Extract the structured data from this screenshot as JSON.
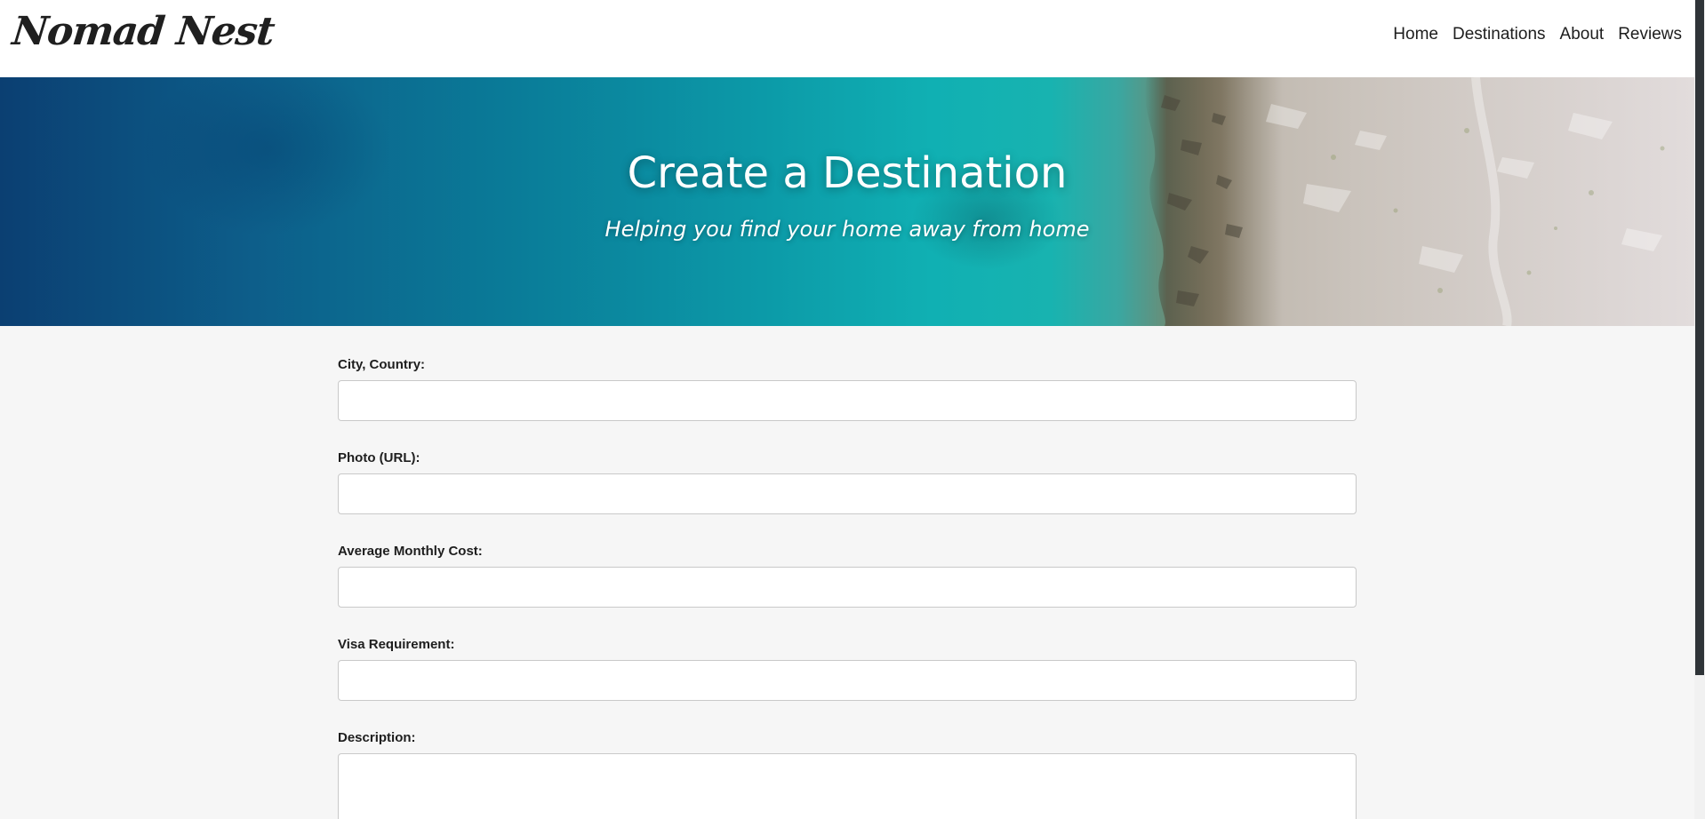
{
  "navbar": {
    "logo": "Nomad Nest",
    "links": [
      {
        "label": "Home"
      },
      {
        "label": "Destinations"
      },
      {
        "label": "About"
      },
      {
        "label": "Reviews"
      }
    ]
  },
  "hero": {
    "title": "Create a Destination",
    "subtitle": "Helping you find your home away from home"
  },
  "form": {
    "fields": [
      {
        "label": "City, Country:",
        "value": "",
        "placeholder": ""
      },
      {
        "label": "Photo (URL):",
        "value": "",
        "placeholder": ""
      },
      {
        "label": "Average Monthly Cost:",
        "value": "",
        "placeholder": ""
      },
      {
        "label": "Visa Requirement:",
        "value": "",
        "placeholder": ""
      },
      {
        "label": "Description:",
        "value": "",
        "placeholder": ""
      }
    ]
  },
  "colors": {
    "page_background": "#f6f6f6",
    "navbar_background": "#ffffff",
    "text": "#1e1e1e",
    "hero_text": "#ffffff",
    "input_border": "#c9c9c9",
    "scrollbar_thumb": "#2f3438"
  }
}
